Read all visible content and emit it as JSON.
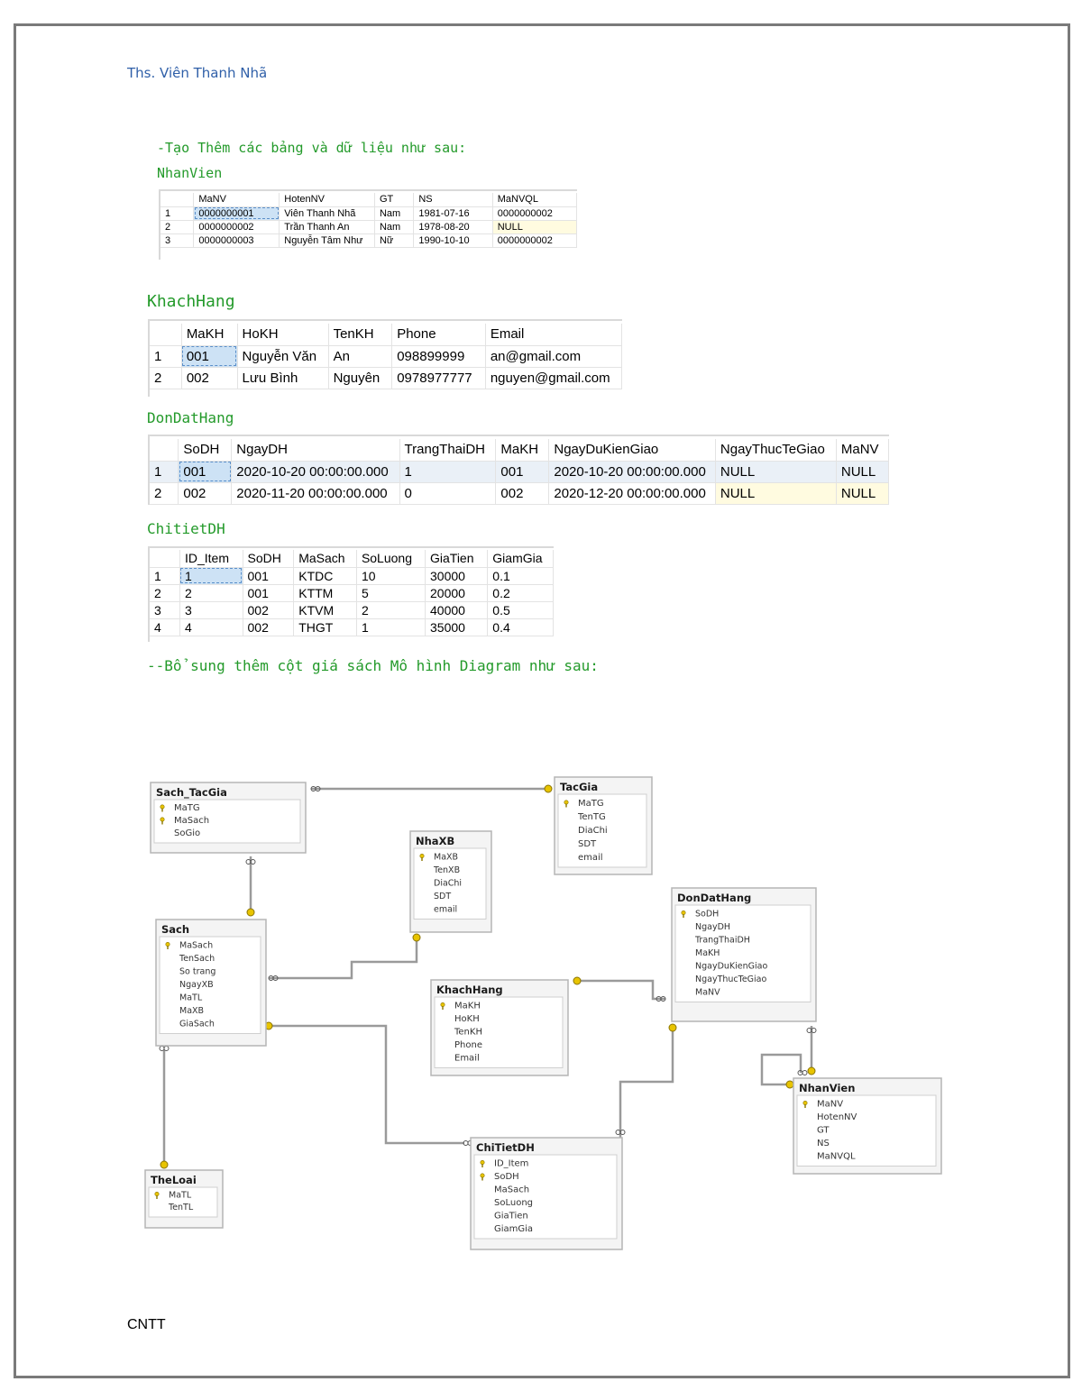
{
  "header": {
    "author": "Ths. Viên Thanh Nhã"
  },
  "intro": {
    "text": "-Tạo Thêm các bảng và dữ liệu như sau:"
  },
  "tables": {
    "nhanvien": {
      "title": "NhanVien",
      "columns": [
        "MaNV",
        "HotenNV",
        "GT",
        "NS",
        "MaNVQL"
      ],
      "rows": [
        {
          "num": "1",
          "cells": [
            "0000000001",
            "Viên Thanh Nhã",
            "Nam",
            "1981-07-16",
            "0000000002"
          ]
        },
        {
          "num": "2",
          "cells": [
            "0000000002",
            "Trần Thanh An",
            "Nam",
            "1978-08-20",
            "NULL"
          ]
        },
        {
          "num": "3",
          "cells": [
            "0000000003",
            "Nguyễn Tâm Như",
            "Nữ",
            "1990-10-10",
            "0000000002"
          ]
        }
      ]
    },
    "khachhang": {
      "title": "KhachHang",
      "columns": [
        "MaKH",
        "HoKH",
        "TenKH",
        "Phone",
        "Email"
      ],
      "rows": [
        {
          "num": "1",
          "cells": [
            "001",
            "Nguyễn Văn",
            "An",
            "098899999",
            "an@gmail.com"
          ]
        },
        {
          "num": "2",
          "cells": [
            "002",
            "Lưu Bình",
            "Nguyên",
            "0978977777",
            "nguyen@gmail.com"
          ]
        }
      ]
    },
    "dondathang": {
      "title": "DonDatHang",
      "columns": [
        "SoDH",
        "NgayDH",
        "TrangThaiDH",
        "MaKH",
        "NgayDuKienGiao",
        "NgayThucTeGiao",
        "MaNV"
      ],
      "rows": [
        {
          "num": "1",
          "cells": [
            "001",
            "2020-10-20 00:00:00.000",
            "1",
            "001",
            "2020-10-20 00:00:00.000",
            "NULL",
            "NULL"
          ]
        },
        {
          "num": "2",
          "cells": [
            "002",
            "2020-11-20 00:00:00.000",
            "0",
            "002",
            "2020-12-20 00:00:00.000",
            "NULL",
            "NULL"
          ]
        }
      ]
    },
    "chitietdh": {
      "title": "ChitietDH",
      "columns": [
        "ID_Item",
        "SoDH",
        "MaSach",
        "SoLuong",
        "GiaTien",
        "GiamGia"
      ],
      "rows": [
        {
          "num": "1",
          "cells": [
            "1",
            "001",
            "KTDC",
            "10",
            "30000",
            "0.1"
          ]
        },
        {
          "num": "2",
          "cells": [
            "2",
            "001",
            "KTTM",
            "5",
            "20000",
            "0.2"
          ]
        },
        {
          "num": "3",
          "cells": [
            "3",
            "002",
            "KTVM",
            "2",
            "40000",
            "0.5"
          ]
        },
        {
          "num": "4",
          "cells": [
            "4",
            "002",
            "THGT",
            "1",
            "35000",
            "0.4"
          ]
        }
      ]
    }
  },
  "note": {
    "text": "--Bổ sung thêm cột giá sách Mô hình Diagram như sau:"
  },
  "diagram": {
    "entities": {
      "sach_tacgia": {
        "title": "Sach_TacGia",
        "fields": [
          "MaTG",
          "MaSach",
          "SoGio"
        ],
        "keys": [
          true,
          true,
          false
        ]
      },
      "tacgia": {
        "title": "TacGia",
        "fields": [
          "MaTG",
          "TenTG",
          "DiaChi",
          "SDT",
          "email"
        ],
        "keys": [
          true,
          false,
          false,
          false,
          false
        ]
      },
      "nhaxb": {
        "title": "NhaXB",
        "fields": [
          "MaXB",
          "TenXB",
          "DiaChi",
          "SDT",
          "email"
        ],
        "keys": [
          true,
          false,
          false,
          false,
          false
        ]
      },
      "dondathang": {
        "title": "DonDatHang",
        "fields": [
          "SoDH",
          "NgayDH",
          "TrangThaiDH",
          "MaKH",
          "NgayDuKienGiao",
          "NgayThucTeGiao",
          "MaNV"
        ],
        "keys": [
          true,
          false,
          false,
          false,
          false,
          false,
          false
        ]
      },
      "sach": {
        "title": "Sach",
        "fields": [
          "MaSach",
          "TenSach",
          "So trang",
          "NgayXB",
          "MaTL",
          "MaXB",
          "GiaSach"
        ],
        "keys": [
          true,
          false,
          false,
          false,
          false,
          false,
          false
        ]
      },
      "khachhang": {
        "title": "KhachHang",
        "fields": [
          "MaKH",
          "HoKH",
          "TenKH",
          "Phone",
          "Email"
        ],
        "keys": [
          true,
          false,
          false,
          false,
          false
        ]
      },
      "nhanvien": {
        "title": "NhanVien",
        "fields": [
          "MaNV",
          "HotenNV",
          "GT",
          "NS",
          "MaNVQL"
        ],
        "keys": [
          true,
          false,
          false,
          false,
          false
        ]
      },
      "theloai": {
        "title": "TheLoai",
        "fields": [
          "MaTL",
          "TenTL"
        ],
        "keys": [
          true,
          false
        ]
      },
      "chitietdh": {
        "title": "ChiTietDH",
        "fields": [
          "ID_Item",
          "SoDH",
          "MaSach",
          "SoLuong",
          "GiaTien",
          "GiamGia"
        ],
        "keys": [
          true,
          true,
          false,
          false,
          false,
          false
        ]
      }
    }
  },
  "footer": {
    "text": "CNTT"
  },
  "colors": {
    "code_green": "#239a2a",
    "author_blue": "#2f5fa8",
    "key_yellow": "#e8c400",
    "selection": "#cde2f5"
  }
}
